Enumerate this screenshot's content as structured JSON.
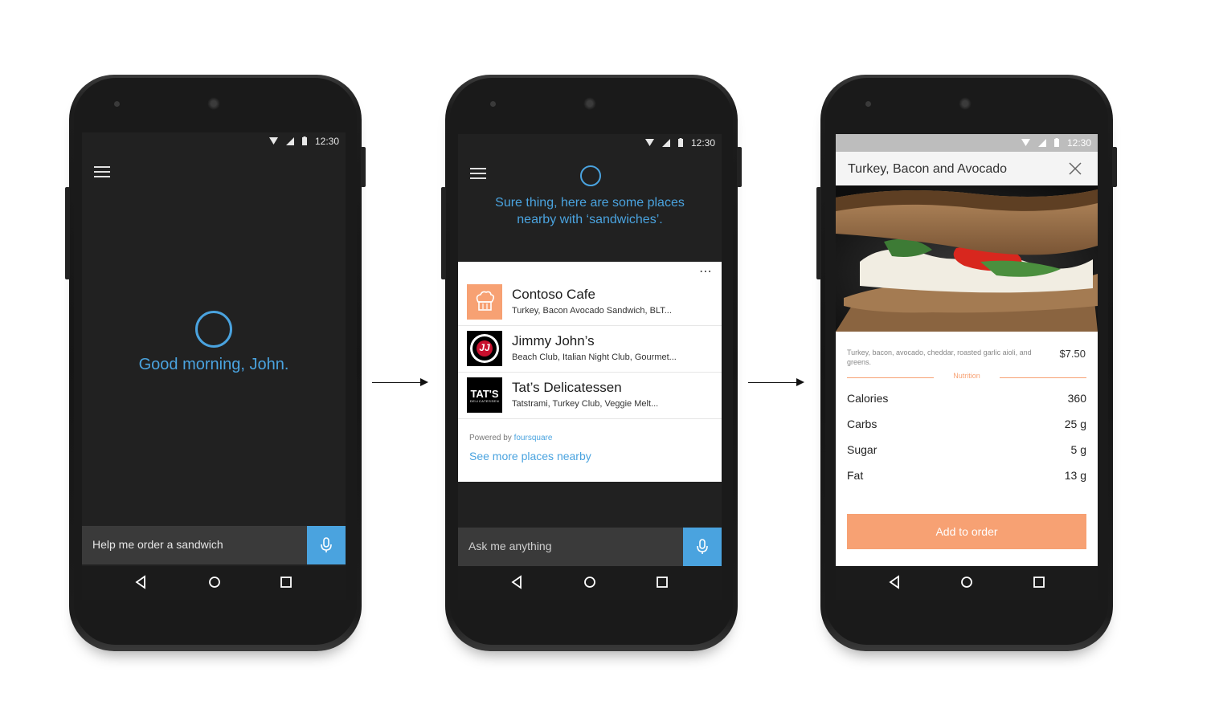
{
  "status": {
    "time": "12:30"
  },
  "phone1": {
    "greeting": "Good morning, John.",
    "query": "Help me order a sandwich"
  },
  "phone2": {
    "response_line1": "Sure thing, here are some places",
    "response_line2": "nearby with ‘sandwiches’.",
    "more_menu": "⋯",
    "places": [
      {
        "name": "Contoso Cafe",
        "desc": "Turkey, Bacon Avocado Sandwich, BLT...",
        "logo": "chef-hat-icon"
      },
      {
        "name": "Jimmy John’s",
        "desc": "Beach Club, Italian Night Club, Gourmet...",
        "logo_text": "JJ"
      },
      {
        "name": "Tat’s Delicatessen",
        "desc": "Tatstrami, Turkey Club, Veggie Melt...",
        "logo_text": "TAT'S",
        "logo_subtext": "DELICATESSEN"
      }
    ],
    "powered_by": "Powered by",
    "powered_brand": "foursquare",
    "see_more": "See more places nearby",
    "ask_placeholder": "Ask me anything"
  },
  "phone3": {
    "title": "Turkey, Bacon and Avocado",
    "description": "Turkey, bacon, avocado, cheddar, roasted garlic aioli, and greens.",
    "price": "$7.50",
    "nutrition_label": "Nutrition",
    "nutrition": [
      {
        "label": "Calories",
        "value": "360"
      },
      {
        "label": "Carbs",
        "value": "25 g"
      },
      {
        "label": "Sugar",
        "value": "5 g"
      },
      {
        "label": "Fat",
        "value": "13 g"
      }
    ],
    "add_button": "Add to order"
  },
  "colors": {
    "cortana_blue": "#4aa3df",
    "accent_orange": "#f7a173",
    "screen_dark": "#212121"
  }
}
